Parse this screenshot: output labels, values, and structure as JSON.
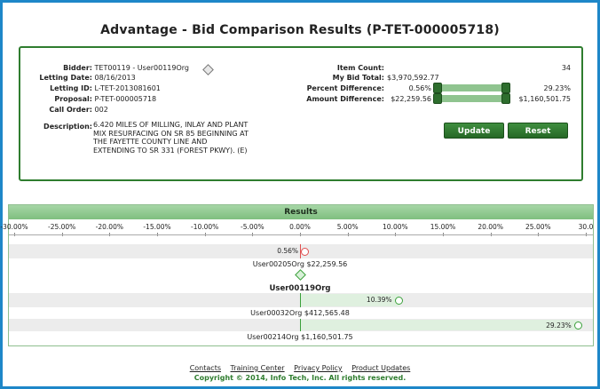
{
  "title": "Advantage - Bid Comparison Results (P-TET-000005718)",
  "info": {
    "bidder_label": "Bidder:",
    "bidder": "TET00119 - User00119Org",
    "letting_date_label": "Letting Date:",
    "letting_date": "08/16/2013",
    "letting_id_label": "Letting ID:",
    "letting_id": "L-TET-2013081601",
    "proposal_label": "Proposal:",
    "proposal": "P-TET-000005718",
    "call_order_label": "Call Order:",
    "call_order": "002",
    "description_label": "Description:",
    "description": "6.420 MILES OF MILLING, INLAY AND PLANT MIX RESURFACING ON SR 85 BEGINNING AT THE FAYETTE COUNTY LINE AND EXTENDING TO SR 331 (FOREST PKWY). (E)",
    "item_count_label": "Item Count:",
    "item_count": "34",
    "my_bid_total_label": "My Bid Total:",
    "my_bid_total": "$3,970,592.77",
    "percent_diff_label": "Percent Difference:",
    "percent_diff_min": "0.56%",
    "percent_diff_max": "29.23%",
    "amount_diff_label": "Amount Difference:",
    "amount_diff_min": "$22,259.56",
    "amount_diff_max": "$1,160,501.75"
  },
  "buttons": {
    "update": "Update",
    "reset": "Reset"
  },
  "results": {
    "header": "Results",
    "axis_ticks": [
      "-30.00%",
      "-25.00%",
      "-20.00%",
      "-15.00%",
      "-10.00%",
      "-5.00%",
      "0.00%",
      "5.00%",
      "10.00%",
      "15.00%",
      "20.00%",
      "25.00%",
      "30.0"
    ],
    "bidders": [
      {
        "pct_label": "0.56%",
        "label": "User00205Org $22,259.56",
        "pct": 0.56,
        "color": "#e05050"
      },
      {
        "pct_label": "",
        "label": "User00119Org",
        "pct": 0,
        "color": "#3aa03a"
      },
      {
        "pct_label": "10.39%",
        "label": "User00032Org $412,565.48",
        "pct": 10.39,
        "color": "#3aa03a"
      },
      {
        "pct_label": "29.23%",
        "label": "User00214Org $1,160,501.75",
        "pct": 29.23,
        "color": "#3aa03a"
      }
    ]
  },
  "footer": {
    "links": [
      "Contacts",
      "Training Center",
      "Privacy Policy",
      "Product Updates"
    ],
    "copyright": "Copyright © 2014, Info Tech, Inc. All rights reserved."
  },
  "colors": {
    "frame": "#1e87c8",
    "accent_green": "#2f7d2f",
    "negative": "#e05050"
  }
}
